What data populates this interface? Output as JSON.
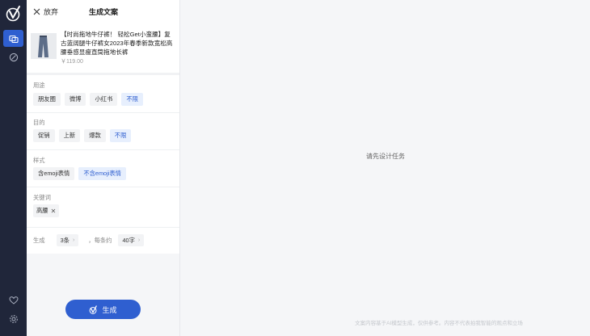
{
  "rail": {
    "logo": "logo-icon",
    "items": [
      {
        "icon": "copywriting-icon",
        "active": true
      },
      {
        "icon": "design-icon",
        "active": false
      }
    ],
    "bottom_items": [
      {
        "icon": "heart-icon"
      },
      {
        "icon": "settings-icon"
      }
    ]
  },
  "panel": {
    "discard_label": "放弃",
    "title": "生成文案"
  },
  "product": {
    "title": "【时尚拖地牛仔裤！ 轻松Get小蛮腰】复古蓝阔腿牛仔裤女2023年春季新款宽松高腰垂感显瘦直筒拖地长裤",
    "price": "￥119.00"
  },
  "sections": {
    "usage": {
      "label": "用途",
      "options": [
        "朋友圈",
        "微博",
        "小红书",
        "不限"
      ],
      "selected": "不限"
    },
    "purpose": {
      "label": "目的",
      "options": [
        "促销",
        "上新",
        "爆款",
        "不限"
      ],
      "selected": "不限"
    },
    "style": {
      "label": "样式",
      "options": [
        "含emoji表情",
        "不含emoji表情"
      ],
      "selected": "不含emoji表情"
    },
    "keywords": {
      "label": "关键词",
      "tags": [
        "高腰"
      ]
    }
  },
  "generate": {
    "label": "生成",
    "count_value": "3条",
    "per_label": "，每条约",
    "length_value": "40字",
    "button_label": "生成"
  },
  "main": {
    "empty_text": "请先设计任务",
    "disclaimer": "文案内容基于AI模型生成，仅供参考。内容不代表拍我智能的观点和立场"
  },
  "colors": {
    "rail_bg": "#20263a",
    "accent": "#2f5fd0",
    "chip_selected_bg": "#e7effd"
  }
}
